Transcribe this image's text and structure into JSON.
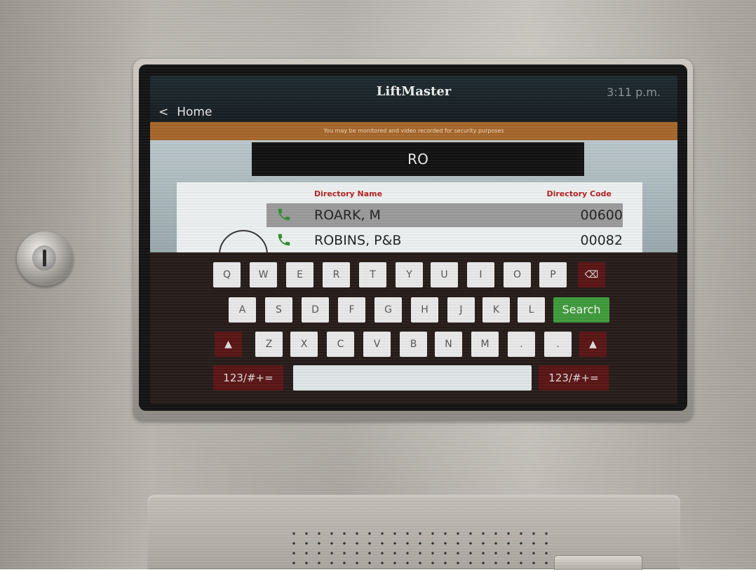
{
  "header": {
    "back_label": "Home",
    "brand": "LiftMaster",
    "time": "3:11 p.m."
  },
  "notice": "You may be monitored and video recorded for security purposes",
  "search": {
    "value": "RO"
  },
  "directory": {
    "col_name": "Directory Name",
    "col_code": "Directory Code",
    "rows": [
      {
        "name": "ROARK, M",
        "code": "00600",
        "selected": true
      },
      {
        "name": "ROBINS, P&B",
        "code": "00082",
        "selected": false
      }
    ]
  },
  "keyboard": {
    "row1": [
      "Q",
      "W",
      "E",
      "R",
      "T",
      "Y",
      "U",
      "I",
      "O",
      "P"
    ],
    "row2": [
      "A",
      "S",
      "D",
      "F",
      "G",
      "H",
      "J",
      "K",
      "L"
    ],
    "row3": [
      "Z",
      "X",
      "C",
      "V",
      "B",
      "N",
      "M",
      ".",
      "."
    ],
    "search_label": "Search",
    "symbols_label": "123/#+=",
    "backspace_icon": "⌫",
    "shift_icon": "▲"
  },
  "colors": {
    "notice_bar": "#a5662a",
    "accent_red": "#b32020",
    "search_green": "#3e9a3a",
    "phone_green": "#2f8f2f"
  }
}
